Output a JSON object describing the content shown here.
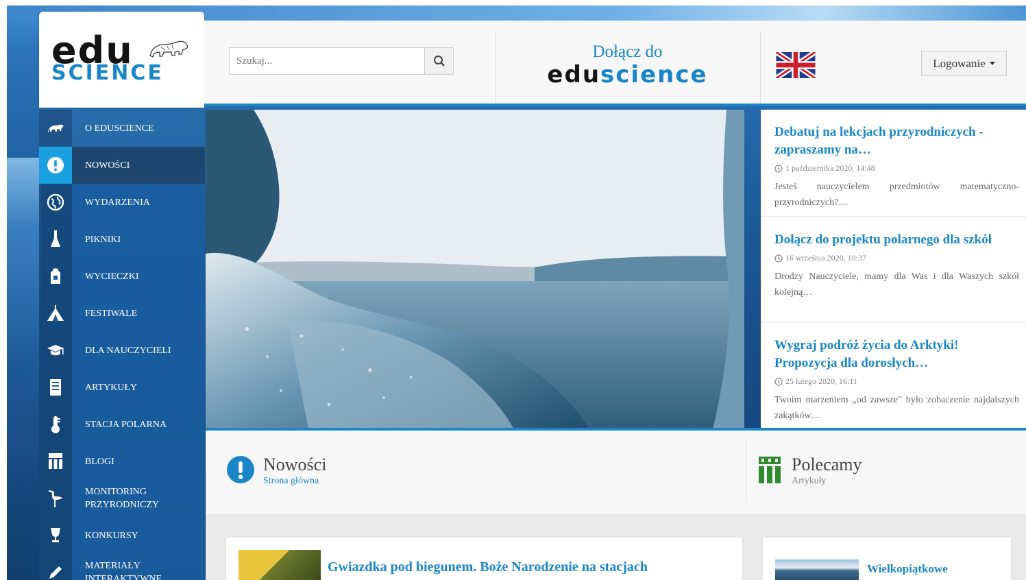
{
  "brand": {
    "logo_top": "edu",
    "logo_bottom": "SCIENCE"
  },
  "header": {
    "search_placeholder": "Szukaj...",
    "join_line1": "Dołącz do",
    "join_line2_a": "edu",
    "join_line2_b": "science",
    "login_label": "Logowanie"
  },
  "sidebar": {
    "items": [
      {
        "label": "O EDUSCIENCE",
        "icon": "polar-bear-icon"
      },
      {
        "label": "NOWOŚCI",
        "icon": "exclamation-icon"
      },
      {
        "label": "WYDARZENIA",
        "icon": "globe-icon"
      },
      {
        "label": "PIKNIKI",
        "icon": "flask-icon"
      },
      {
        "label": "WYCIECZKI",
        "icon": "backpack-icon"
      },
      {
        "label": "FESTIWALE",
        "icon": "tent-icon"
      },
      {
        "label": "DLA NAUCZYCIELI",
        "icon": "graduation-cap-icon"
      },
      {
        "label": "ARTYKUŁY",
        "icon": "document-icon"
      },
      {
        "label": "STACJA POLARNA",
        "icon": "thermometer-icon"
      },
      {
        "label": "BLOGI",
        "icon": "people-icon"
      },
      {
        "label": "MONITORING PRZYRODNICZY",
        "icon": "stork-icon"
      },
      {
        "label": "KONKURSY",
        "icon": "trophy-icon"
      },
      {
        "label": "MATERIAŁY INTERAKTYWNE",
        "icon": "pencil-icon"
      }
    ]
  },
  "news": [
    {
      "title": "Debatuj na lekcjach przyrodniczych - zapraszamy na…",
      "date": "1 października 2020, 14:48",
      "excerpt": "Jesteś nauczycielem przedmiotów matematyczno-przyrodniczych?…"
    },
    {
      "title": "Dołącz do projektu polarnego dla szkół",
      "date": "16 września 2020, 10:37",
      "excerpt": "Drodzy Nauczyciele, mamy dla Was i dla Waszych szkół kolejną…"
    },
    {
      "title": "Wygraj podróż życia do Arktyki! Propozycja dla dorosłych…",
      "date": "25 lutego 2020, 16:11",
      "excerpt": "Twoim marzeniem „od zawsze\" było zobaczenie najdalszych zakątków…"
    }
  ],
  "sections": {
    "left_title": "Nowości",
    "left_sub": "Strona główna",
    "right_title": "Polecamy",
    "right_sub": "Artykuły"
  },
  "articles": {
    "main_title": "Gwiazdka pod biegunem. Boże Narodzenie na stacjach",
    "side_title": "Wielkopiątkowe"
  },
  "colors": {
    "accent": "#1a86c8",
    "sidebar_active": "#1aa0de"
  }
}
